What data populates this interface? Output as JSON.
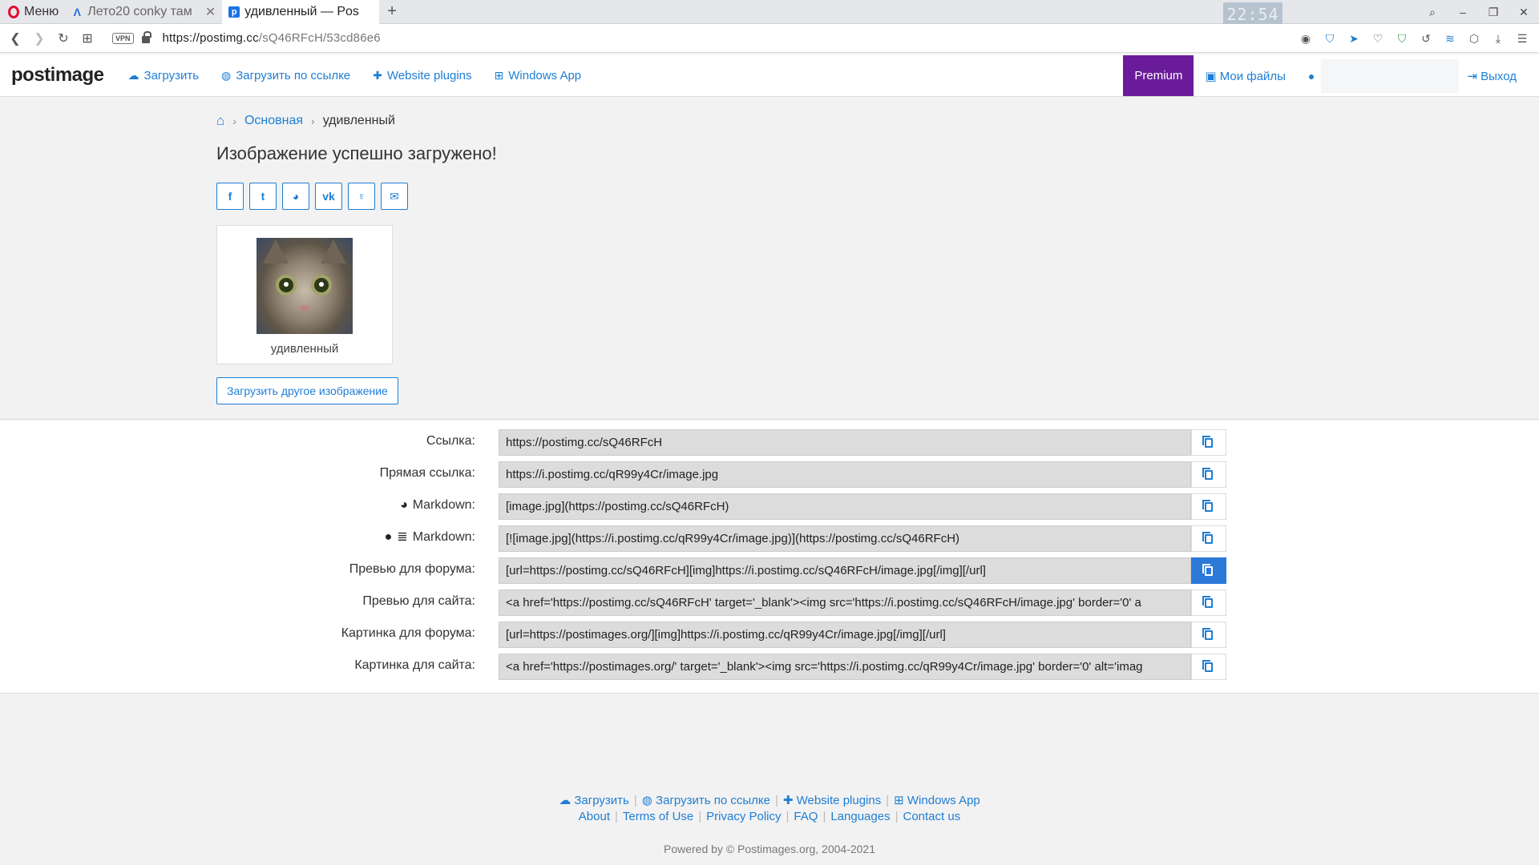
{
  "browser": {
    "menu_label": "Меню",
    "tabs": [
      {
        "title": "Лето20 conky там",
        "active": false
      },
      {
        "title": "удивленный — Pos",
        "active": true
      }
    ],
    "new_tab": "+",
    "clock": "22:54",
    "url_host": "https://postimg.cc",
    "url_path": "/sQ46RFcH/53cd86e6",
    "vpn_label": "VPN"
  },
  "site": {
    "logo": "postimage",
    "nav": [
      {
        "label": "Загрузить",
        "icon": "cloud-upload-icon"
      },
      {
        "label": "Загрузить по ссылке",
        "icon": "globe-icon"
      },
      {
        "label": "Website plugins",
        "icon": "puzzle-icon"
      },
      {
        "label": "Windows App",
        "icon": "windows-icon"
      }
    ],
    "premium": "Premium",
    "my_files": "Мои файлы",
    "logout": "Выход"
  },
  "breadcrumb": {
    "parent": "Основная",
    "current": "удивленный"
  },
  "page_title": "Изображение успешно загружено!",
  "share_buttons": [
    "facebook-icon",
    "twitter-icon",
    "reddit-icon",
    "vk-icon",
    "odnoklassniki-icon",
    "email-icon"
  ],
  "thumbnail": {
    "caption": "удивленный"
  },
  "upload_another": "Загрузить другое изображение",
  "links": [
    {
      "label": "Ссылка:",
      "value": "https://postimg.cc/sQ46RFcH"
    },
    {
      "label": "Прямая ссылка:",
      "value": "https://i.postimg.cc/qR99y4Cr/image.jpg"
    },
    {
      "label": "Markdown:",
      "value": "[image.jpg](https://postimg.cc/sQ46RFcH)"
    },
    {
      "label": "Markdown:",
      "value": "[![image.jpg](https://i.postimg.cc/qR99y4Cr/image.jpg)](https://postimg.cc/sQ46RFcH)"
    },
    {
      "label": "Превью для форума:",
      "value": "[url=https://postimg.cc/sQ46RFcH][img]https://i.postimg.cc/sQ46RFcH/image.jpg[/img][/url]"
    },
    {
      "label": "Превью для сайта:",
      "value": "<a href='https://postimg.cc/sQ46RFcH' target='_blank'><img src='https://i.postimg.cc/sQ46RFcH/image.jpg' border='0' a"
    },
    {
      "label": "Картинка для форума:",
      "value": "[url=https://postimages.org/][img]https://i.postimg.cc/qR99y4Cr/image.jpg[/img][/url]"
    },
    {
      "label": "Картинка для сайта:",
      "value": "<a href='https://postimages.org/' target='_blank'><img src='https://i.postimg.cc/qR99y4Cr/image.jpg' border='0' alt='imag"
    }
  ],
  "footer": {
    "row1": [
      "Загрузить",
      "Загрузить по ссылке",
      "Website plugins",
      "Windows App"
    ],
    "row2": [
      "About",
      "Terms of Use",
      "Privacy Policy",
      "FAQ",
      "Languages",
      "Contact us"
    ],
    "powered": "Powered by © Postimages.org, 2004-2021"
  },
  "colors": {
    "accent": "#1e7ed4",
    "premium": "#6a1b9a",
    "copy_active": "#2a78d8"
  }
}
